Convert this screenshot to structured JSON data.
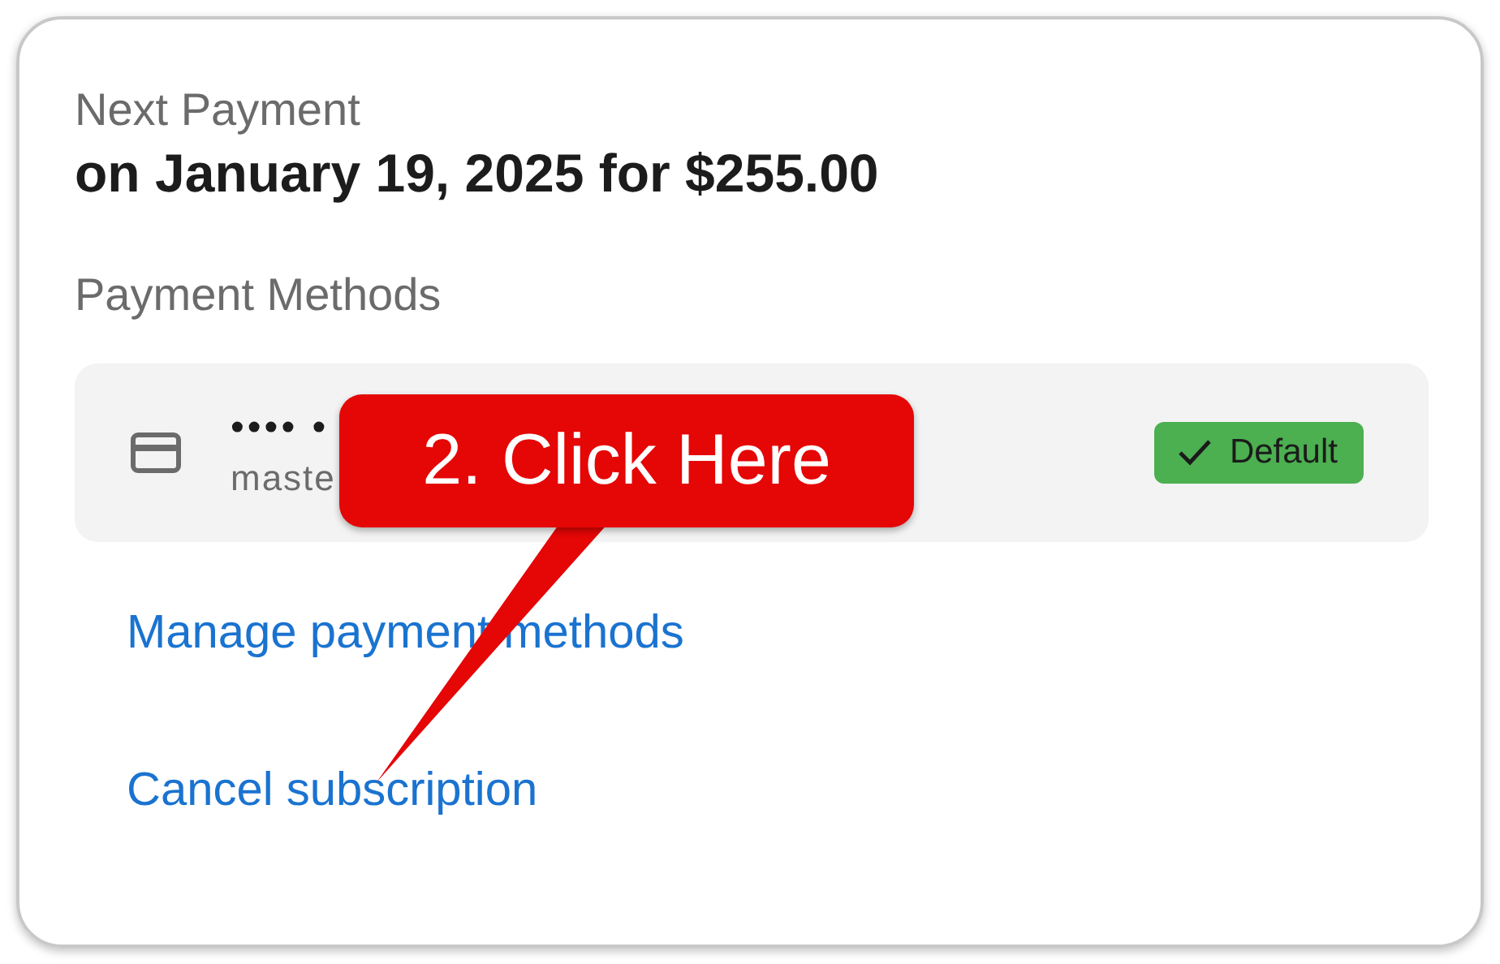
{
  "next_payment": {
    "label": "Next Payment",
    "value": "on January 19, 2025 for $255.00"
  },
  "payment_methods": {
    "label": "Payment Methods",
    "items": [
      {
        "number": "•••• •",
        "brand": "maste",
        "badge": "Default",
        "default": true
      }
    ]
  },
  "links": [
    "Manage payment methods",
    "Cancel subscription"
  ],
  "callout": {
    "text": "2. Click Here"
  }
}
